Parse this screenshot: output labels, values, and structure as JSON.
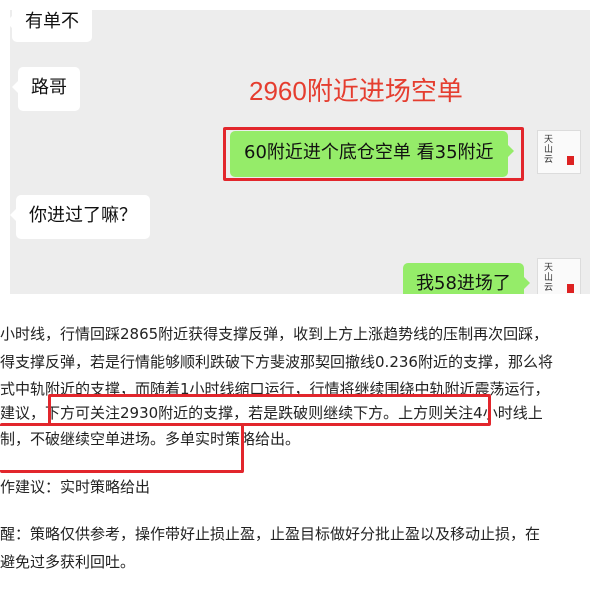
{
  "chat": {
    "messages": [
      {
        "side": "left",
        "text": "有单不"
      },
      {
        "side": "left",
        "text": "路哥"
      },
      {
        "side": "right",
        "text": "60附近进个底仓空单   看35附近"
      },
      {
        "side": "left",
        "text": "你进过了嘛？"
      },
      {
        "side": "right",
        "text": "我58进场了"
      }
    ],
    "title_overlay": "2960附近进场空单",
    "avatar_text": "天山云"
  },
  "article": {
    "lines": [
      "小时线，行情回踩2865附近获得支撑反弹，收到上方上涨趋势线的压制再次回踩，",
      "得支撑反弹，若是行情能够顺利跌破下方斐波那契回撤线0.236附近的支撑，那么将",
      "式中轨附近的支撑，而随着1小时线缩口运行，行情将继续围绕中轨附近震荡运行，",
      "建议，下方可关注2930附近的支撑，若是跌破则继续下方。上方则关注4小时线上",
      "制，不破继续空单进场。多单实时策略给出。",
      "作建议：实时策略给出",
      "醒：策略仅供参考，操作带好止损止盈，止盈目标做好分批止盈以及移动止损，在",
      "避免过多获利回吐。"
    ]
  },
  "colors": {
    "chat_bg": "#ededed",
    "green_bubble": "#95ec69",
    "highlight_red": "#e2262c",
    "title_red": "#e53d2f"
  }
}
